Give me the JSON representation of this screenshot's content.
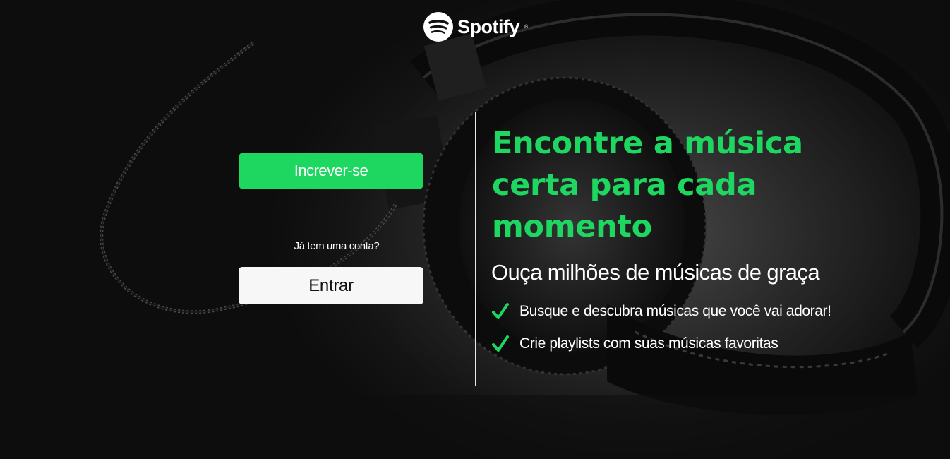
{
  "brand": {
    "name": "Spotify",
    "trademark": "®",
    "accent_color": "#1ed760"
  },
  "auth": {
    "signup_label": "Increver-se",
    "have_account_text": "Já tem uma conta?",
    "login_label": "Entrar"
  },
  "hero": {
    "headline": "Encontre a música certa para cada momento",
    "subheadline": "Ouça milhões de músicas de graça",
    "features": [
      {
        "icon": "check-icon",
        "text": "Busque e descubra músicas que você vai adorar!"
      },
      {
        "icon": "check-icon",
        "text": "Crie playlists com suas músicas favoritas"
      }
    ]
  },
  "background": {
    "description_icon": "headphones-background-image"
  }
}
